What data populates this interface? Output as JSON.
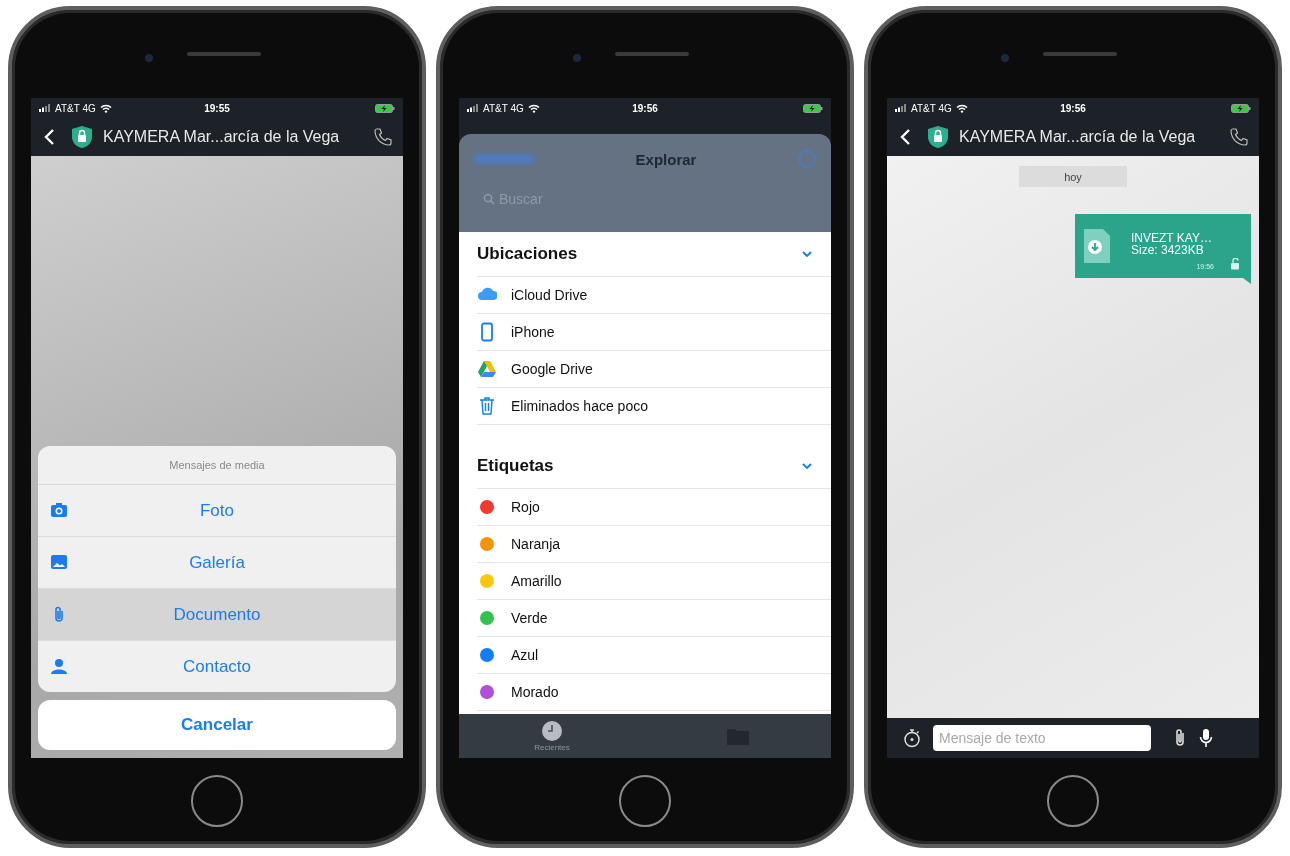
{
  "phones": [
    {
      "kind": "chat_sheet",
      "status": {
        "carrier": "AT&T 4G",
        "time": "19:55"
      },
      "header": {
        "title": "KAYMERA Mar...arcía de la Vega"
      },
      "sheet": {
        "title": "Mensajes de media",
        "options": [
          {
            "kind": "camera",
            "label": "Foto",
            "selected": false
          },
          {
            "kind": "image",
            "label": "Galería",
            "selected": false
          },
          {
            "kind": "clip",
            "label": "Documento",
            "selected": true
          },
          {
            "kind": "person",
            "label": "Contacto",
            "selected": false
          }
        ],
        "cancel": "Cancelar"
      }
    },
    {
      "kind": "browser",
      "status": {
        "carrier": "AT&T 4G",
        "time": "19:56"
      },
      "browser": {
        "title": "Explorar",
        "search_placeholder": "Buscar",
        "sections": [
          {
            "title": "Ubicaciones",
            "expanded": true,
            "items": [
              {
                "kind": "cloud",
                "label": "iCloud Drive"
              },
              {
                "kind": "phone",
                "label": "iPhone"
              },
              {
                "kind": "drive",
                "label": "Google Drive"
              },
              {
                "kind": "trash",
                "label": "Eliminados hace poco"
              }
            ]
          },
          {
            "title": "Etiquetas",
            "expanded": true,
            "items": [
              {
                "kind": "tag",
                "label": "Rojo",
                "color": "#f03a30"
              },
              {
                "kind": "tag",
                "label": "Naranja",
                "color": "#f7920c"
              },
              {
                "kind": "tag",
                "label": "Amarillo",
                "color": "#fbc70a"
              },
              {
                "kind": "tag",
                "label": "Verde",
                "color": "#33c24f"
              },
              {
                "kind": "tag",
                "label": "Azul",
                "color": "#127ef5"
              },
              {
                "kind": "tag",
                "label": "Morado",
                "color": "#b14fd9"
              }
            ]
          }
        ],
        "tabs": [
          {
            "kind": "clock",
            "label": "Recientes",
            "selected": true
          },
          {
            "kind": "folder",
            "selected": false
          }
        ]
      }
    },
    {
      "kind": "chat",
      "status": {
        "carrier": "AT&T 4G",
        "time": "19:56"
      },
      "header": {
        "title": "KAYMERA Mar...arcía de la Vega"
      },
      "date_label": "hoy",
      "messages": [
        {
          "kind": "file",
          "name": "INVEZT KAY…",
          "size": "Size: 3423KB",
          "time": "19:56"
        }
      ],
      "composer": {
        "placeholder": "Mensaje de texto"
      }
    }
  ]
}
